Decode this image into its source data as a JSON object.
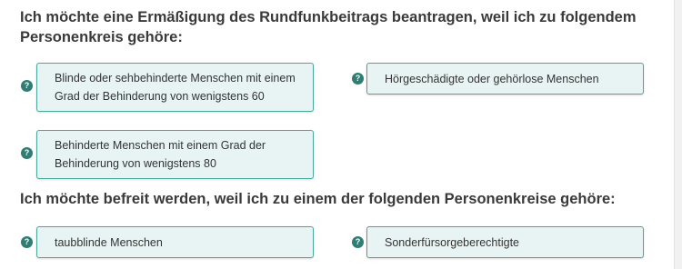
{
  "section1": {
    "heading": "Ich möchte eine Ermäßigung des Rundfunkbeitrags beantragen, weil ich zu folgendem Personenkreis gehöre:",
    "options": [
      {
        "label": "Blinde oder sehbehinderte Menschen mit einem Grad der Behinderung von wenigstens 60"
      },
      {
        "label": "Hörgeschädigte oder gehörlose Menschen"
      },
      {
        "label": "Behinderte Menschen mit einem Grad der Behinderung von wenigstens 80"
      }
    ]
  },
  "section2": {
    "heading": "Ich möchte befreit werden, weil ich zu einem der folgenden Personenkreise gehöre:",
    "options": [
      {
        "label": "taubblinde Menschen"
      },
      {
        "label": "Sonderfürsorgeberechtigte"
      }
    ]
  },
  "help_glyph": "?",
  "colors": {
    "option_background": "#e7f4f3",
    "option_border": "#4aa79c",
    "help_icon": "#2f7d73",
    "heading_text": "#3a3a3a"
  }
}
